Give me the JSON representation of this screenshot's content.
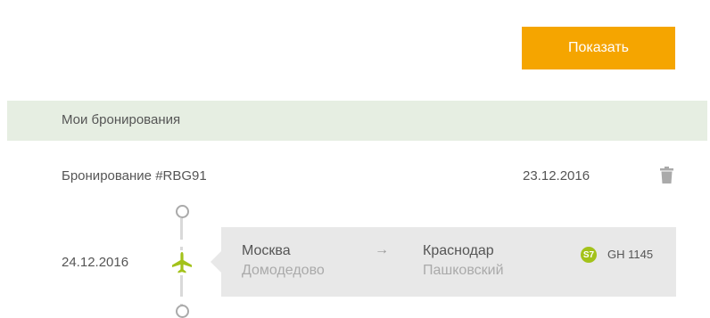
{
  "actions": {
    "show_label": "Показать"
  },
  "section": {
    "title": "Мои бронирования"
  },
  "booking": {
    "number": "Бронирование #RBG91",
    "date": "23.12.2016"
  },
  "flight": {
    "date": "24.12.2016",
    "from_city": "Москва",
    "from_airport": "Домодедово",
    "arrow": "→",
    "to_city": "Краснодар",
    "to_airport": "Пашковский",
    "airline_logo_text": "S7",
    "flight_number": "GH 1145"
  },
  "icons": {
    "trash": "trash-icon",
    "plane": "plane-icon",
    "timeline_start": "circle-icon",
    "timeline_end": "circle-icon"
  },
  "colors": {
    "accent": "#f5a500",
    "header_bg": "#e6eee2",
    "plane": "#a3c21a",
    "card_bg": "#e8e8e8"
  }
}
